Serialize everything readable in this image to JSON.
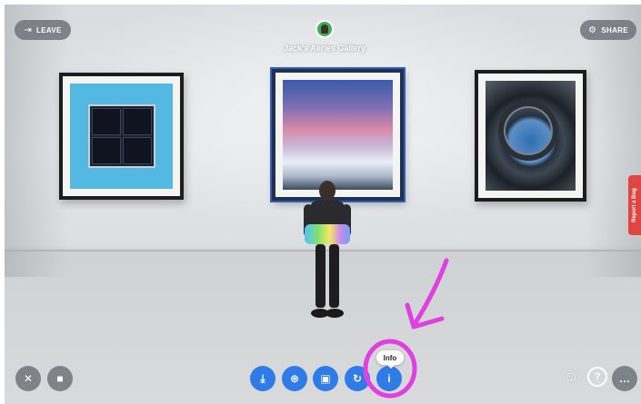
{
  "header": {
    "leave_label": "LEAVE",
    "share_label": "SHARE",
    "gallery_title": "Jack's Aeries Gallery"
  },
  "side_tab": {
    "report_label": "Report a Bug"
  },
  "toolbar": {
    "tooltip_label": "Info",
    "more_label": "…",
    "help_label": "?"
  },
  "icons": {
    "leave": "exit-icon",
    "share": "share-icon",
    "mic": "mic-muted-icon",
    "camera": "camera-off-icon",
    "download": "download-icon",
    "zoom": "zoom-icon",
    "lock": "lock-icon",
    "refresh": "refresh-icon",
    "info": "info-icon",
    "accessibility": "accessibility-icon",
    "help": "help-icon",
    "more": "more-icon"
  },
  "colors": {
    "accent_blue": "#2f7ce8",
    "annotation_magenta": "#e040e0",
    "report_red": "#e0463f"
  }
}
